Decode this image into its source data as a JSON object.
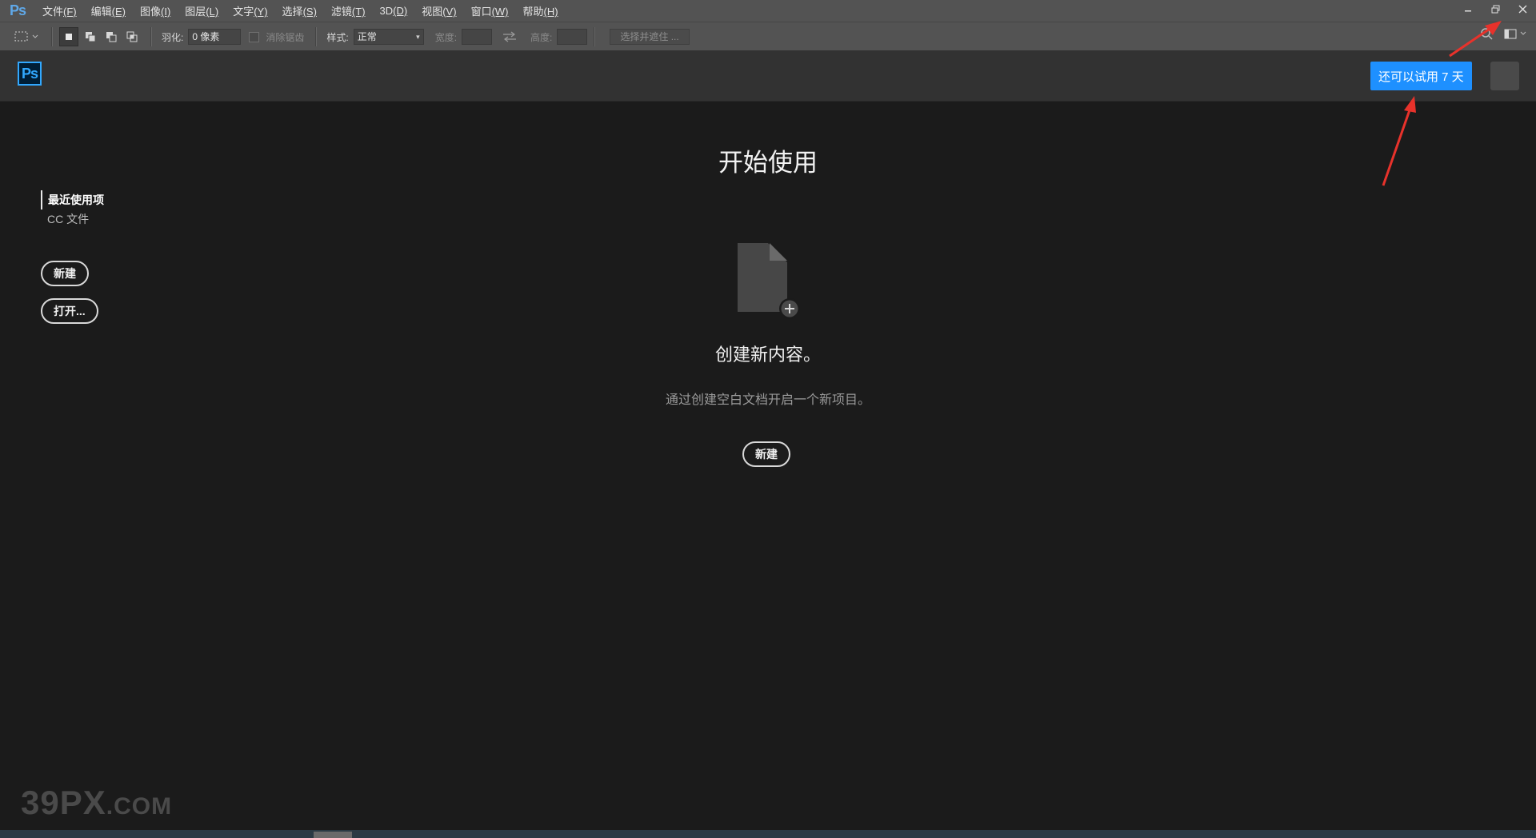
{
  "app": {
    "short_name": "Ps"
  },
  "menu": [
    {
      "label": "文件",
      "key": "(F)"
    },
    {
      "label": "编辑",
      "key": "(E)"
    },
    {
      "label": "图像",
      "key": "(I)"
    },
    {
      "label": "图层",
      "key": "(L)"
    },
    {
      "label": "文字",
      "key": "(Y)"
    },
    {
      "label": "选择",
      "key": "(S)"
    },
    {
      "label": "滤镜",
      "key": "(T)"
    },
    {
      "label": "3D",
      "key": "(D)"
    },
    {
      "label": "视图",
      "key": "(V)"
    },
    {
      "label": "窗口",
      "key": "(W)"
    },
    {
      "label": "帮助",
      "key": "(H)"
    }
  ],
  "options": {
    "feather_label": "羽化:",
    "feather_value": "0 像素",
    "antialias_label": "消除锯齿",
    "style_label": "样式:",
    "style_value": "正常",
    "width_label": "宽度:",
    "height_label": "高度:",
    "mask_button": "选择并遮住 ..."
  },
  "header": {
    "trial_button": "还可以试用 7 天"
  },
  "sidebar": {
    "items": [
      {
        "label": "最近使用项",
        "active": true
      },
      {
        "label": "CC 文件",
        "active": false
      }
    ],
    "new_button": "新建",
    "open_button": "打开..."
  },
  "main": {
    "title": "开始使用",
    "create_title": "创建新内容。",
    "create_subtitle": "通过创建空白文档开启一个新项目。",
    "new_button": "新建"
  },
  "watermark": {
    "brand": "39PX",
    "suffix": ".COM"
  },
  "colors": {
    "accent": "#1e90ff",
    "ps_blue": "#31a8ff",
    "annotation_red": "#e8322b"
  }
}
